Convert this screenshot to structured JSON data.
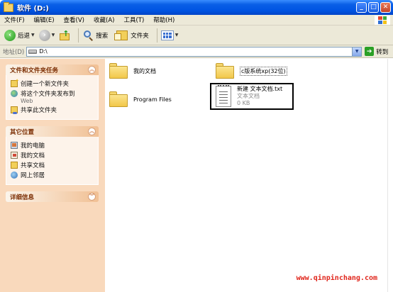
{
  "window": {
    "title": "软件 (D:)"
  },
  "menu": [
    "文件(F)",
    "编辑(E)",
    "查看(V)",
    "收藏(A)",
    "工具(T)",
    "帮助(H)"
  ],
  "toolbar": {
    "back_label": "后退",
    "search_label": "搜索",
    "folders_label": "文件夹"
  },
  "address": {
    "label": "地址(D)",
    "value": "D:\\",
    "go_label": "转到"
  },
  "taskpane": {
    "file_tasks": {
      "title": "文件和文件夹任务",
      "items": [
        {
          "label": "创建一个新文件夹",
          "sub": ""
        },
        {
          "label": "将这个文件夹发布到",
          "sub": "Web"
        },
        {
          "label": "共享此文件夹",
          "sub": ""
        }
      ]
    },
    "other_places": {
      "title": "其它位置",
      "items": [
        "我的电脑",
        "我的文档",
        "共享文档",
        "网上邻居"
      ]
    },
    "details": {
      "title": "详细信息"
    }
  },
  "files": [
    {
      "name": "我的文档",
      "kind": "folder"
    },
    {
      "name": "c版系统xp(32位)",
      "kind": "folder"
    },
    {
      "name": "Program Files",
      "kind": "folder"
    },
    {
      "name": "新建 文本文档.txt",
      "kind": "text",
      "type": "文本文档",
      "size": "0 KB"
    }
  ],
  "watermark": "www.qinpinchang.com",
  "colors": {
    "titlebar": "#0054e3",
    "taskpane": "#f9d9bc",
    "panel_title": "#7a2b00",
    "watermark": "#e0251b"
  }
}
